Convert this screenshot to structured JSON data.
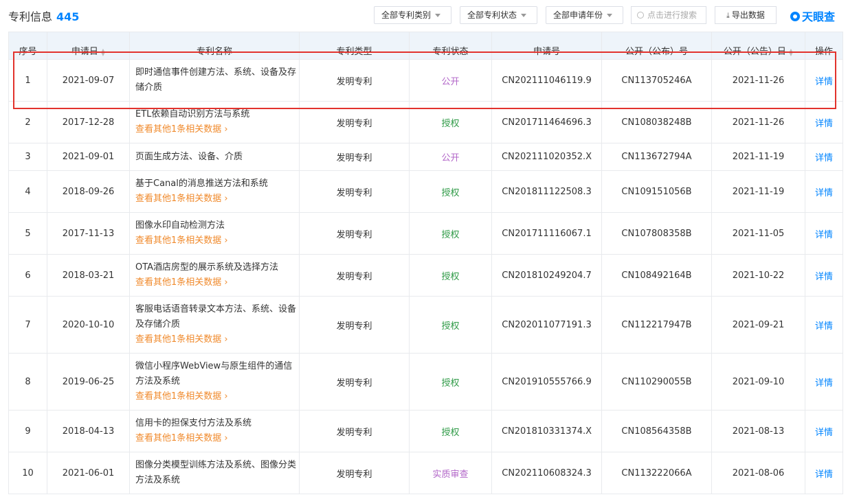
{
  "header": {
    "title": "专利信息",
    "count": "445",
    "filter_category": "全部专利类别",
    "filter_status": "全部专利状态",
    "filter_year": "全部申请年份",
    "search_placeholder": "点击进行搜索",
    "export_label": "导出数据",
    "logo_text": "天眼查"
  },
  "columns": [
    "序号",
    "申请日",
    "专利名称",
    "专利类型",
    "专利状态",
    "申请号",
    "公开（公布）号",
    "公开（公告）日",
    "操作"
  ],
  "related_link": "查看其他1条相关数据 ›",
  "rows": [
    {
      "no": "1",
      "date": "2021-09-07",
      "name": "即时通信事件创建方法、系统、设备及存储介质",
      "type": "发明专利",
      "status": "公开",
      "app_no": "CN202111046119.9",
      "pub_no": "CN113705246A",
      "pub_date": "2021-11-26",
      "action": "详情",
      "more": false
    },
    {
      "no": "2",
      "date": "2017-12-28",
      "name": "ETL依赖自动识别方法与系统",
      "type": "发明专利",
      "status": "授权",
      "app_no": "CN201711464696.3",
      "pub_no": "CN108038248B",
      "pub_date": "2021-11-26",
      "action": "详情",
      "more": true
    },
    {
      "no": "3",
      "date": "2021-09-01",
      "name": "页面生成方法、设备、介质",
      "type": "发明专利",
      "status": "公开",
      "app_no": "CN202111020352.X",
      "pub_no": "CN113672794A",
      "pub_date": "2021-11-19",
      "action": "详情",
      "more": false
    },
    {
      "no": "4",
      "date": "2018-09-26",
      "name": "基于Canal的消息推送方法和系统",
      "type": "发明专利",
      "status": "授权",
      "app_no": "CN201811122508.3",
      "pub_no": "CN109151056B",
      "pub_date": "2021-11-19",
      "action": "详情",
      "more": true
    },
    {
      "no": "5",
      "date": "2017-11-13",
      "name": "图像水印自动检测方法",
      "type": "发明专利",
      "status": "授权",
      "app_no": "CN201711116067.1",
      "pub_no": "CN107808358B",
      "pub_date": "2021-11-05",
      "action": "详情",
      "more": true
    },
    {
      "no": "6",
      "date": "2018-03-21",
      "name": "OTA酒店房型的展示系统及选择方法",
      "type": "发明专利",
      "status": "授权",
      "app_no": "CN201810249204.7",
      "pub_no": "CN108492164B",
      "pub_date": "2021-10-22",
      "action": "详情",
      "more": true
    },
    {
      "no": "7",
      "date": "2020-10-10",
      "name": "客服电话语音转录文本方法、系统、设备及存储介质",
      "type": "发明专利",
      "status": "授权",
      "app_no": "CN202011077191.3",
      "pub_no": "CN112217947B",
      "pub_date": "2021-09-21",
      "action": "详情",
      "more": true
    },
    {
      "no": "8",
      "date": "2019-06-25",
      "name": "微信小程序WebView与原生组件的通信方法及系统",
      "type": "发明专利",
      "status": "授权",
      "app_no": "CN201910555766.9",
      "pub_no": "CN110290055B",
      "pub_date": "2021-09-10",
      "action": "详情",
      "more": true
    },
    {
      "no": "9",
      "date": "2018-04-13",
      "name": "信用卡的担保支付方法及系统",
      "type": "发明专利",
      "status": "授权",
      "app_no": "CN201810331374.X",
      "pub_no": "CN108564358B",
      "pub_date": "2021-08-13",
      "action": "详情",
      "more": true
    },
    {
      "no": "10",
      "date": "2021-06-01",
      "name": "图像分类模型训练方法及系统、图像分类方法及系统",
      "type": "发明专利",
      "status": "实质审查",
      "app_no": "CN202110608324.3",
      "pub_no": "CN113222066A",
      "pub_date": "2021-08-06",
      "action": "详情",
      "more": false
    }
  ]
}
